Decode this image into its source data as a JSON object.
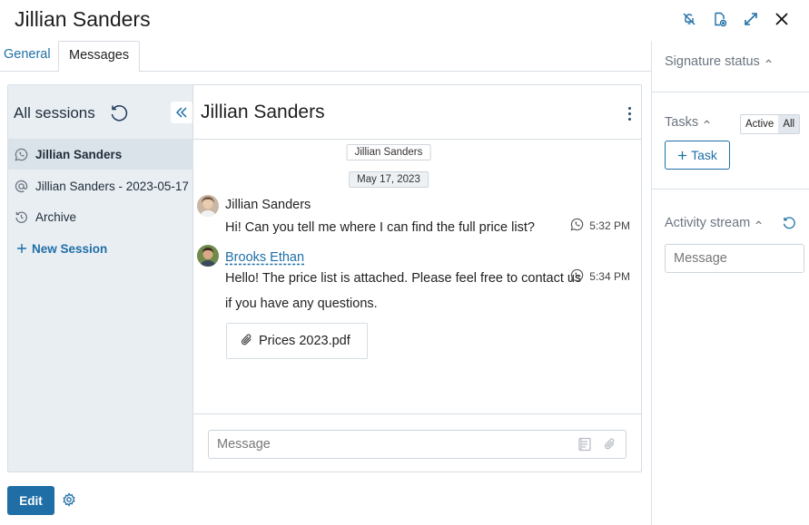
{
  "window": {
    "title": "Jillian Sanders",
    "icons": [
      "bell-off-icon",
      "document-export-icon",
      "expand-icon",
      "close-icon"
    ]
  },
  "tabs": [
    {
      "label": "General",
      "active": false
    },
    {
      "label": "Messages",
      "active": true
    }
  ],
  "sessions": {
    "header": "All sessions",
    "items": [
      {
        "label": "Jillian Sanders",
        "icon": "whatsapp-icon",
        "active": true
      },
      {
        "label": "Jillian Sanders - 2023-05-17",
        "icon": "email-at-icon",
        "active": false
      },
      {
        "label": "Archive",
        "icon": "history-icon",
        "active": false
      }
    ],
    "new_session": "New Session"
  },
  "chat": {
    "title": "Jillian Sanders",
    "contact_chip": "Jillian Sanders",
    "date_chip": "May 17, 2023",
    "messages": [
      {
        "sender": "Jillian Sanders",
        "text": "Hi! Can you tell me where I can find the full price list?",
        "time": "5:32 PM",
        "channel_icon": "whatsapp-icon"
      },
      {
        "sender": "Brooks Ethan",
        "text_line1": "Hello! The price list is attached. Please feel free to contact us",
        "text_line2": "if you have any questions.",
        "time": "5:34 PM",
        "channel_icon": "whatsapp-icon",
        "attachment": "Prices 2023.pdf"
      }
    ],
    "compose_placeholder": "Message"
  },
  "footer": {
    "edit_label": "Edit"
  },
  "right_panel": {
    "signature_status": "Signature status",
    "tasks_label": "Tasks",
    "toggle_active": "Active",
    "toggle_all": "All",
    "add_task": "Task",
    "activity_stream": "Activity stream",
    "message_placeholder": "Message"
  },
  "colors": {
    "accent": "#1f6fa6",
    "sidebar_bg": "#e9eef3",
    "border": "#d6dde3"
  }
}
